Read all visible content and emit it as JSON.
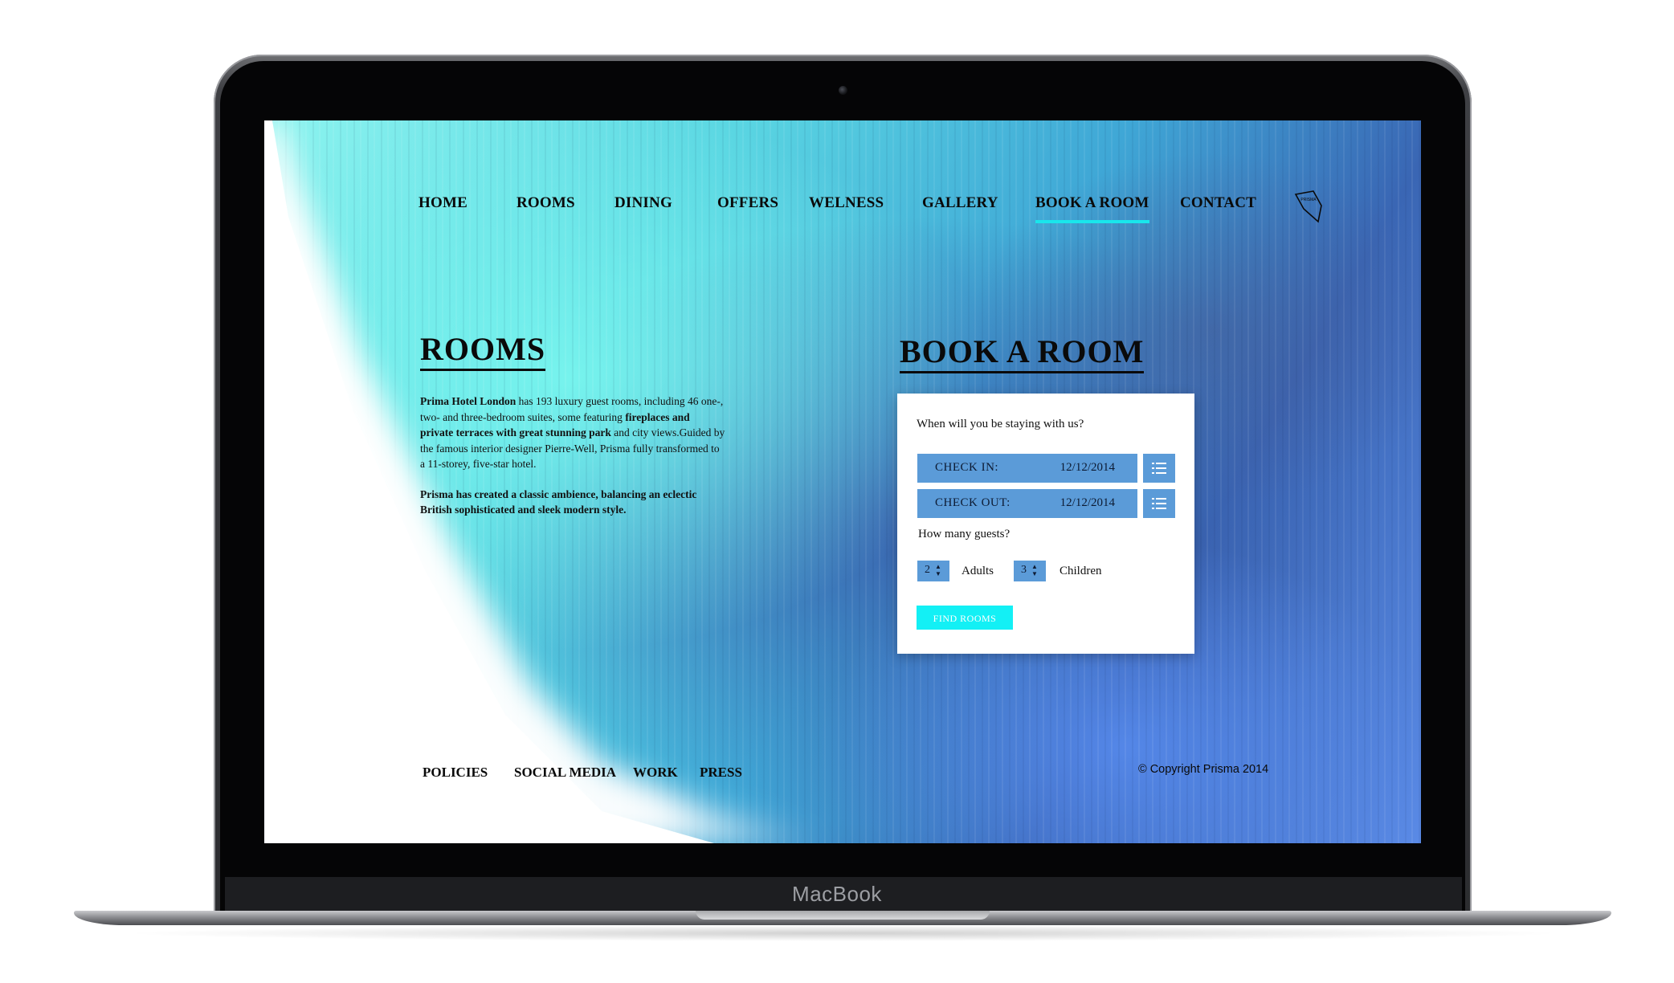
{
  "device": {
    "brand_label": "MacBook"
  },
  "nav": {
    "items": [
      {
        "label": "HOME"
      },
      {
        "label": "ROOMS"
      },
      {
        "label": "DINING"
      },
      {
        "label": "OFFERS"
      },
      {
        "label": "WELNESS"
      },
      {
        "label": "GALLERY"
      },
      {
        "label": "BOOK A ROOM",
        "active": true
      },
      {
        "label": "CONTACT"
      }
    ],
    "logo_text": "PRISMA",
    "accent_color": "#19e6ec"
  },
  "rooms": {
    "title": "ROOMS",
    "p1_hotel": "Prima Hotel London",
    "p1_a": " has 193 luxury guest rooms, including 46 one-, two- and three-bedroom suites, some featuring ",
    "p1_bold": "fireplaces and private terraces with great stunning park",
    "p1_b": " and city views.Guided by  the famous interior designer Pierre-Well, Prisma fully transformed to a 11-storey, five-star hotel.",
    "p2": "Prisma has created a classic ambience, balancing an eclectic British sophisticated and sleek modern style."
  },
  "booking": {
    "title": "BOOK A ROOM",
    "stay_question": "When will you be staying with us?",
    "check_in_label": "CHECK  IN:",
    "check_in_value": "12/12/2014",
    "check_out_label": "CHECK  OUT:",
    "check_out_value": "12/12/2014",
    "guests_question": "How many guests?",
    "adults_value": "2",
    "adults_label": "Adults",
    "children_value": "3",
    "children_label": "Children",
    "find_button": "FIND ROOMS",
    "field_color": "#5b9bd8",
    "button_color": "#13f0f5"
  },
  "footer": {
    "links": [
      {
        "label": "POLICIES"
      },
      {
        "label": "SOCIAL MEDIA"
      },
      {
        "label": "WORK"
      },
      {
        "label": "PRESS"
      }
    ],
    "copyright": "© Copyright Prisma 2014"
  }
}
